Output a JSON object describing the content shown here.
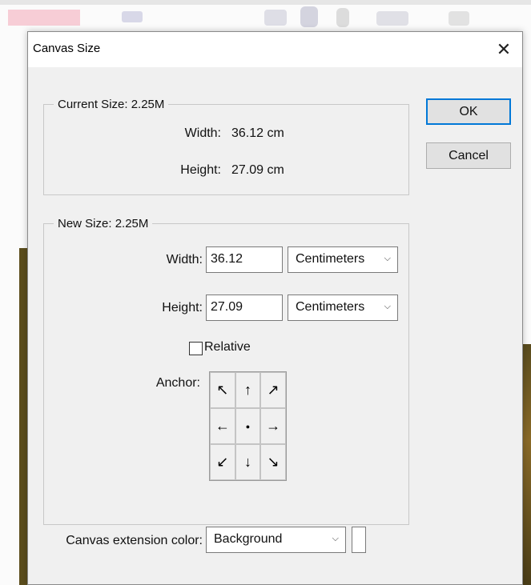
{
  "dialog": {
    "title": "Canvas Size",
    "close_icon": "close-icon"
  },
  "current_size": {
    "legend": "Current Size: 2.25M",
    "width_label": "Width:",
    "width_value": "36.12 cm",
    "height_label": "Height:",
    "height_value": "27.09 cm"
  },
  "new_size": {
    "legend": "New Size: 2.25M",
    "width_label": "Width:",
    "width_value": "36.12",
    "width_unit": "Centimeters",
    "height_label": "Height:",
    "height_value": "27.09",
    "height_unit": "Centimeters",
    "relative_label": "Relative",
    "relative_checked": false,
    "anchor_label": "Anchor:",
    "anchor_cells": [
      {
        "name": "anchor-top-left",
        "icon": "arrow-up-left-icon",
        "glyph": "↖"
      },
      {
        "name": "anchor-top",
        "icon": "arrow-up-icon",
        "glyph": "↑"
      },
      {
        "name": "anchor-top-right",
        "icon": "arrow-up-right-icon",
        "glyph": "↗"
      },
      {
        "name": "anchor-left",
        "icon": "arrow-left-icon",
        "glyph": "←"
      },
      {
        "name": "anchor-center",
        "icon": "dot-icon",
        "glyph": "●"
      },
      {
        "name": "anchor-right",
        "icon": "arrow-right-icon",
        "glyph": "→"
      },
      {
        "name": "anchor-bottom-left",
        "icon": "arrow-down-left-icon",
        "glyph": "↙"
      },
      {
        "name": "anchor-bottom",
        "icon": "arrow-down-icon",
        "glyph": "↓"
      },
      {
        "name": "anchor-bottom-right",
        "icon": "arrow-down-right-icon",
        "glyph": "↘"
      }
    ]
  },
  "extension": {
    "label": "Canvas extension color:",
    "value": "Background",
    "swatch_color": "#ffffff"
  },
  "buttons": {
    "ok": "OK",
    "cancel": "Cancel"
  },
  "colors": {
    "dialog_bg": "#f0f0f0",
    "default_button_border": "#0078d7"
  }
}
